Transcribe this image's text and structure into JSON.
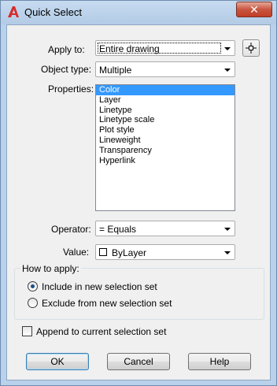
{
  "window": {
    "title": "Quick Select",
    "close_symbol": "✕"
  },
  "apply_to": {
    "label": "Apply to:",
    "value": "Entire drawing"
  },
  "object_type": {
    "label": "Object type:",
    "value": "Multiple"
  },
  "properties": {
    "label": "Properties:",
    "items": [
      "Color",
      "Layer",
      "Linetype",
      "Linetype scale",
      "Plot style",
      "Lineweight",
      "Transparency",
      "Hyperlink"
    ],
    "selected_index": 0
  },
  "operator": {
    "label": "Operator:",
    "value": "= Equals"
  },
  "value": {
    "label": "Value:",
    "value": "ByLayer"
  },
  "how_to_apply": {
    "title": "How to apply:",
    "include_label": "Include in new selection set",
    "exclude_label": "Exclude from new selection set",
    "selected": "include"
  },
  "append": {
    "label": "Append to current selection set",
    "checked": false
  },
  "buttons": {
    "ok": "OK",
    "cancel": "Cancel",
    "help": "Help"
  }
}
